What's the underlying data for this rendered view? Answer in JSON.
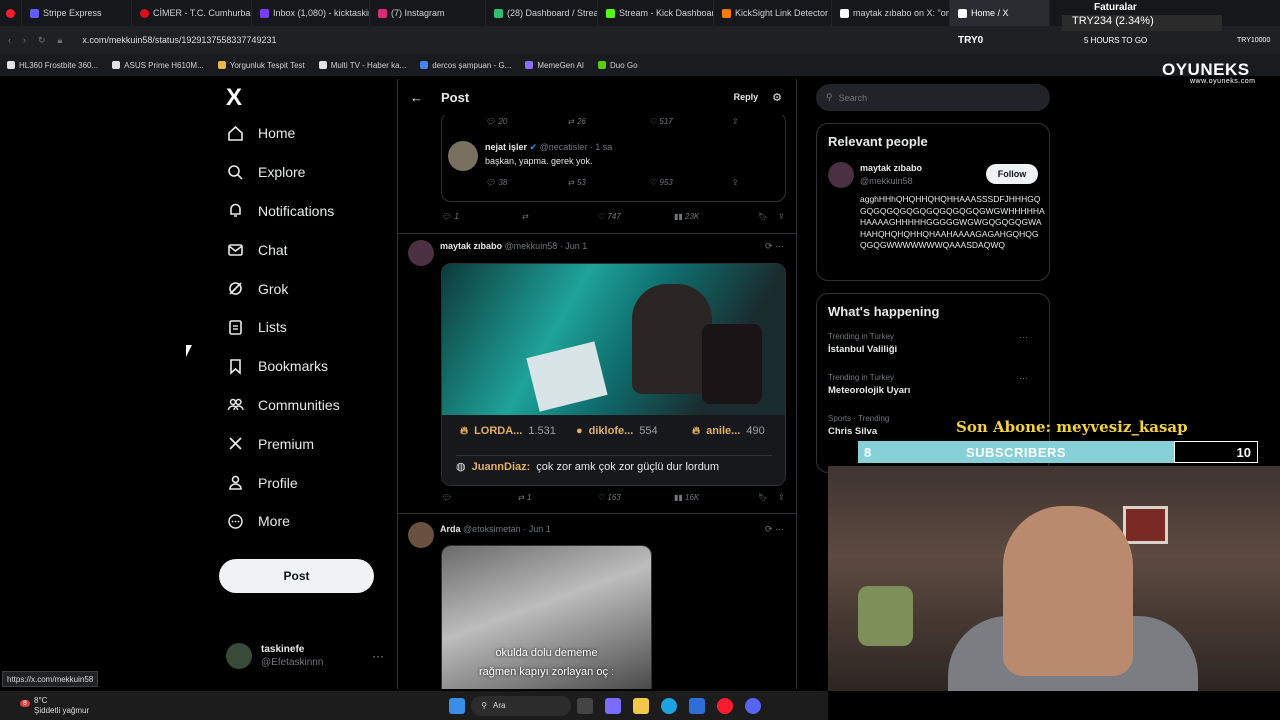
{
  "browser": {
    "tabs": [
      {
        "label": "Stripe Express",
        "color": "#635bff"
      },
      {
        "label": "CİMER - T.C. Cumhurbaşk",
        "color": "#e30a17"
      },
      {
        "label": "Inbox (1,080) - kicktaskin",
        "color": "#7a3cff"
      },
      {
        "label": "(7) Instagram",
        "color": "#dd2a7b"
      },
      {
        "label": "(28) Dashboard / Streamla",
        "color": "#2fbf71"
      },
      {
        "label": "Stream - Kick Dashboard",
        "color": "#53fc18"
      },
      {
        "label": "KickSight Link Detector",
        "color": "#ff7a00"
      },
      {
        "label": "maytak zıbabo on X: \"onc",
        "color": "#ffffff"
      },
      {
        "label": "Home / X",
        "color": "#ffffff"
      }
    ],
    "url": "x.com/mekkuin58/status/1929137558337749231",
    "bookmarks": [
      {
        "label": "HL360 Frostbite 360...",
        "color": "#e2e2e2"
      },
      {
        "label": "ASUS Prime H610M...",
        "color": "#e2e2e2"
      },
      {
        "label": "Yorgunluk Tespit Test",
        "color": "#e9b84a"
      },
      {
        "label": "Multi TV - Haber ka...",
        "color": "#e2e2e2"
      },
      {
        "label": "dercos şampuan - G...",
        "color": "#4285f4"
      },
      {
        "label": "MemeGen AI",
        "color": "#8a6cff"
      },
      {
        "label": "Duo Go",
        "color": "#58cc02"
      }
    ],
    "status_url": "https://x.com/mekkuin58"
  },
  "overlay": {
    "faturalar": "Faturalar",
    "try_value": "TRY234 (2.34%)",
    "try0": "TRY0",
    "hours_to_go": "5 HOURS TO GO",
    "try10000": "TRY10000",
    "brand": "OYUNEKS",
    "brand_url": "www.oyuneks.com",
    "son_abone": "Son Abone: meyvesiz_kasap",
    "sub_current": "8",
    "sub_label": "SUBSCRIBERS",
    "sub_goal": "10"
  },
  "sidebar": {
    "logo": "X",
    "items": [
      {
        "label": "Home",
        "icon": "home-icon"
      },
      {
        "label": "Explore",
        "icon": "search-icon"
      },
      {
        "label": "Notifications",
        "icon": "bell-icon"
      },
      {
        "label": "Chat",
        "icon": "mail-icon"
      },
      {
        "label": "Grok",
        "icon": "grok-icon"
      },
      {
        "label": "Lists",
        "icon": "list-icon"
      },
      {
        "label": "Bookmarks",
        "icon": "bookmark-icon"
      },
      {
        "label": "Communities",
        "icon": "people-icon"
      },
      {
        "label": "Premium",
        "icon": "x-icon"
      },
      {
        "label": "Profile",
        "icon": "user-icon"
      },
      {
        "label": "More",
        "icon": "more-icon"
      }
    ],
    "post_button": "Post",
    "account": {
      "name": "taskinefe",
      "handle": "@Efetaskinnn"
    }
  },
  "timeline": {
    "header": {
      "title": "Post",
      "reply": "Reply"
    },
    "quote": {
      "stats_top": [
        "20",
        "26",
        "517"
      ],
      "name": "nejat işler",
      "handle": "@necatisler",
      "time": "· 1 sa",
      "text": "başkan, yapma. gerek yok.",
      "stats": [
        "38",
        "53",
        "953"
      ]
    },
    "quote_actions": [
      "1",
      "",
      "747",
      "23K"
    ],
    "tweet1": {
      "name": "maytak zıbabo",
      "handle": "@mekkuin58",
      "time": "· Jun 1",
      "leaderboard": [
        {
          "name": "LORDA...",
          "value": "1.531"
        },
        {
          "name": "diklofe...",
          "value": "554"
        },
        {
          "name": "anile...",
          "value": "490"
        }
      ],
      "chat_user": "JuannDiaz:",
      "chat_text": "çok zor amk çok zor güçlü dur lordum",
      "actions": [
        "",
        "1",
        "163",
        "16K"
      ]
    },
    "tweet2": {
      "name": "Arda",
      "handle": "@etoksimetan",
      "time": "· Jun 1",
      "caption_line1": "okulda dolu dememe",
      "caption_line2": "rağmen kapıyı zorlayan oç :"
    }
  },
  "right": {
    "search_placeholder": "Search",
    "relevant_title": "Relevant people",
    "person": {
      "name": "maytak zıbabo",
      "handle": "@mekkuin58",
      "follow": "Follow",
      "bio": "agghHHhQHQHHQHQHHAAASSSDFJHHHGQGQGQGQGQGQGQGQGQGQGWGWHHHHHAHAAAAGHHHHHGGGGGWGWGQGQGQGWAHAHQHQHQHHQHAAHAAAAGAGAHGQHQGQGQGWWWWWWWQAAASDAQWQ"
    },
    "happening_title": "What's happening",
    "trends": [
      {
        "meta": "Trending in Turkey",
        "title": "İstanbul Valiliği"
      },
      {
        "meta": "Trending in Turkey",
        "title": "Meteorolojik Uyarı"
      },
      {
        "meta": "Sports · Trending",
        "title": "Chris Silva"
      }
    ]
  },
  "taskbar": {
    "weather_temp": "8°C",
    "weather_desc": "Şiddetli yağmur",
    "weather_badge": "8",
    "search": "Ara"
  }
}
